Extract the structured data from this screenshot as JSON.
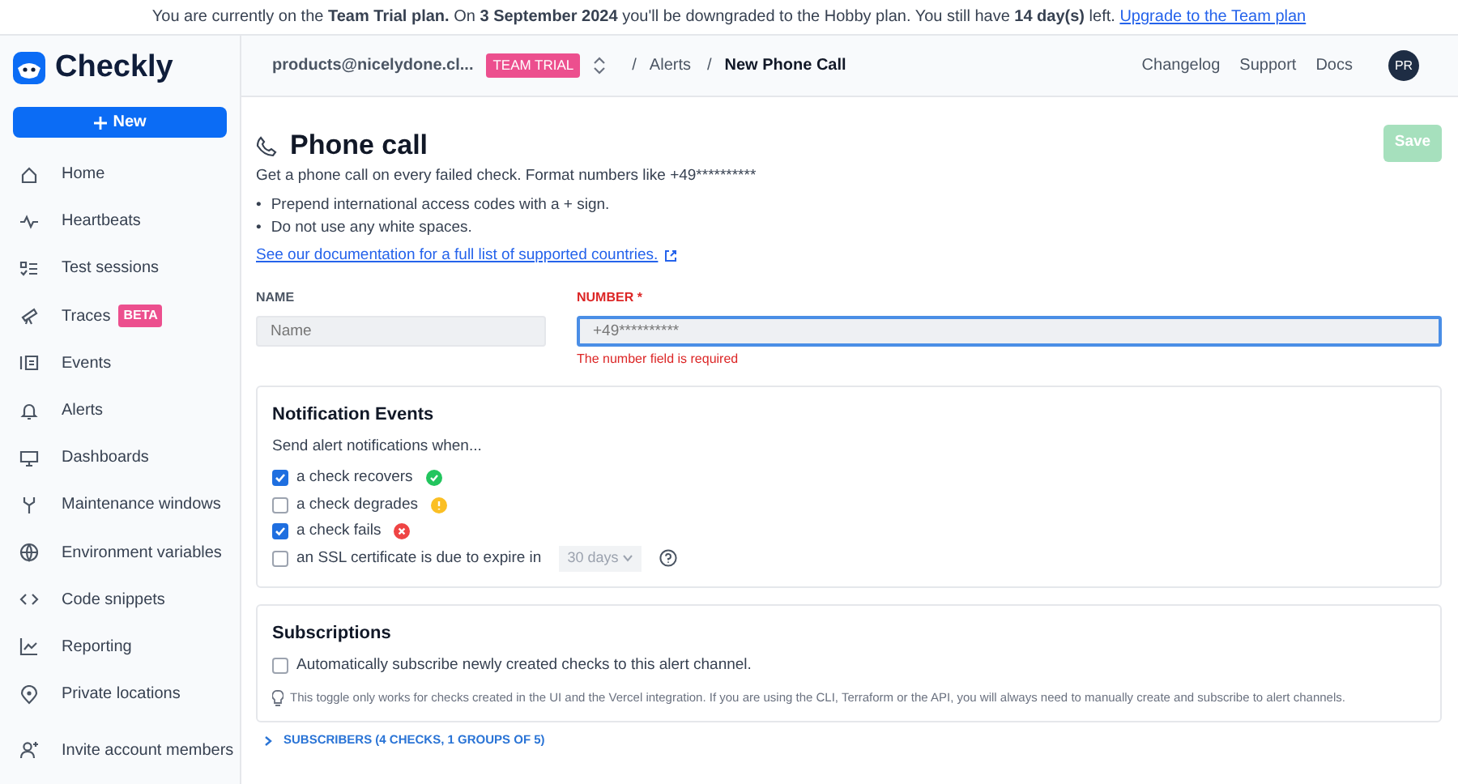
{
  "banner": {
    "text": "You are currently on the **Team Trial plan.** On **3 September 2024** you'll be downgraded to the Hobby plan. You still have **14 day(s)** left.",
    "link": "Upgrade to the Team plan"
  },
  "sidebar": {
    "logo": "Checkly",
    "new_button": "New",
    "items": [
      {
        "label": "Home"
      },
      {
        "label": "Heartbeats"
      },
      {
        "label": "Test sessions"
      },
      {
        "label": "Traces",
        "badge": "BETA"
      },
      {
        "label": "Events"
      },
      {
        "label": "Alerts"
      },
      {
        "label": "Dashboards"
      },
      {
        "label": "Maintenance windows"
      },
      {
        "label": "Environment variables"
      },
      {
        "label": "Code snippets"
      },
      {
        "label": "Reporting"
      },
      {
        "label": "Private locations"
      }
    ],
    "footer_items": [
      {
        "label": "Invite account members"
      }
    ]
  },
  "header": {
    "account": "products@nicelydone.cl...",
    "plan_badge": "TEAM TRIAL",
    "breadcrumbs": [
      {
        "separator": "/",
        "label": "Alerts"
      },
      {
        "separator": "/",
        "label": "New Phone Call"
      }
    ],
    "links": [
      "Changelog",
      "Support",
      "Docs"
    ],
    "avatar": "PR"
  },
  "page": {
    "title": "Phone call",
    "save_button": {
      "label": "Save",
      "disabled": true
    },
    "description": "Get a phone call on every failed check. Format numbers like +49**********",
    "bullets": [
      {
        "marker": "•",
        "text": "Prepend international access codes with a + sign."
      },
      {
        "marker": "•",
        "text": "Do not use any white spaces."
      }
    ],
    "doc_link": "See our documentation for a full list of supported countries.",
    "name_field": {
      "label": "NAME",
      "placeholder": "Name"
    },
    "number_field": {
      "label": "NUMBER *",
      "placeholder": "+49**********",
      "error": "The number field is required"
    }
  },
  "notification_events": {
    "title": "Notification Events",
    "subtitle": "Send alert notifications when...",
    "events": [
      {
        "kind": "status",
        "label": "a check recovers",
        "checked": true,
        "indicator": {
          "kind": "success",
          "color": "#22c55e"
        }
      },
      {
        "kind": "status",
        "label": "a check degrades",
        "checked": false,
        "indicator": {
          "kind": "warning",
          "color": "#fbbf24"
        }
      },
      {
        "kind": "status",
        "label": "a check fails",
        "checked": true,
        "indicator": {
          "kind": "error",
          "color": "#ef4444"
        }
      },
      {
        "kind": "ssl",
        "label": "an SSL certificate is due to expire in",
        "checked": false,
        "select": "30 days"
      }
    ]
  },
  "subscriptions": {
    "title": "Subscriptions",
    "option": {
      "label": "Automatically subscribe newly created checks to this alert channel.",
      "checked": false
    },
    "hint": "This toggle only works for checks created in the UI and the Vercel integration. If you are using the CLI, Terraform or the API, you will always need to manually create and subscribe to alert channels.",
    "subscribers": {
      "label": "SUBSCRIBERS (4 CHECKS, 1 GROUPS OF 5)",
      "expanded": false
    }
  }
}
